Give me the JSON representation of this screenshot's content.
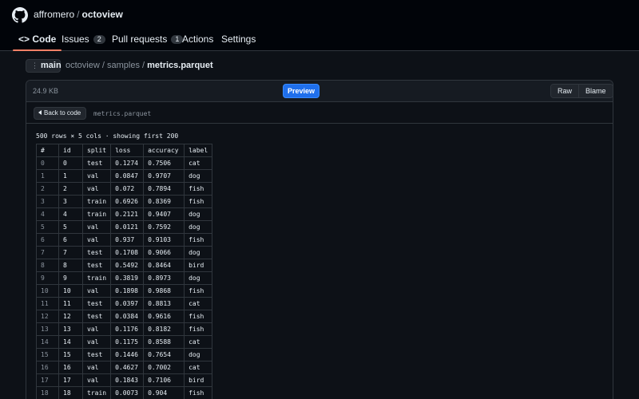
{
  "repo": {
    "owner": "affromero",
    "separator": "/",
    "name": "octoview"
  },
  "tabs": [
    {
      "label": "<> Code",
      "active": true
    },
    {
      "label": "Issues",
      "count": "2"
    },
    {
      "label": "Pull requests",
      "count": "1"
    },
    {
      "label": "Actions"
    },
    {
      "label": "Settings"
    }
  ],
  "branch": {
    "label": "main"
  },
  "breadcrumb": {
    "repo": "octoview",
    "folder": "samples",
    "file": "metrics.parquet",
    "separator": "/"
  },
  "file_header": {
    "size": "24.9 KB",
    "preview_label": "Preview",
    "raw_label": "Raw",
    "blame_label": "Blame"
  },
  "viewer": {
    "back_label": "Back to code",
    "filename": "metrics.parquet",
    "summary": "500 rows × 5 cols · showing first 200"
  },
  "table": {
    "columns": [
      "#",
      "id",
      "split",
      "loss",
      "accuracy",
      "label"
    ],
    "rows": [
      [
        "0",
        "0",
        "test",
        "0.1274",
        "0.7506",
        "cat"
      ],
      [
        "1",
        "1",
        "val",
        "0.0847",
        "0.9707",
        "dog"
      ],
      [
        "2",
        "2",
        "val",
        "0.072",
        "0.7894",
        "fish"
      ],
      [
        "3",
        "3",
        "train",
        "0.6926",
        "0.8369",
        "fish"
      ],
      [
        "4",
        "4",
        "train",
        "0.2121",
        "0.9407",
        "dog"
      ],
      [
        "5",
        "5",
        "val",
        "0.0121",
        "0.7592",
        "dog"
      ],
      [
        "6",
        "6",
        "val",
        "0.937",
        "0.9103",
        "fish"
      ],
      [
        "7",
        "7",
        "test",
        "0.1708",
        "0.9066",
        "dog"
      ],
      [
        "8",
        "8",
        "test",
        "0.5492",
        "0.8464",
        "bird"
      ],
      [
        "9",
        "9",
        "train",
        "0.3819",
        "0.8973",
        "dog"
      ],
      [
        "10",
        "10",
        "val",
        "0.1898",
        "0.9868",
        "fish"
      ],
      [
        "11",
        "11",
        "test",
        "0.0397",
        "0.8813",
        "cat"
      ],
      [
        "12",
        "12",
        "test",
        "0.0384",
        "0.9616",
        "fish"
      ],
      [
        "13",
        "13",
        "val",
        "0.1176",
        "0.8182",
        "fish"
      ],
      [
        "14",
        "14",
        "val",
        "0.1175",
        "0.8588",
        "cat"
      ],
      [
        "15",
        "15",
        "test",
        "0.1446",
        "0.7654",
        "dog"
      ],
      [
        "16",
        "16",
        "val",
        "0.4627",
        "0.7002",
        "cat"
      ],
      [
        "17",
        "17",
        "val",
        "0.1843",
        "0.7106",
        "bird"
      ],
      [
        "18",
        "18",
        "train",
        "0.0073",
        "0.904",
        "fish"
      ]
    ]
  },
  "colors": {
    "accent": "#1f6feb",
    "tab_underline": "#f78166",
    "background": "#0d1117"
  },
  "icons": {
    "logo": "github-mark-icon",
    "branch": "branch-grip-icon",
    "back": "triangle-left-icon"
  }
}
